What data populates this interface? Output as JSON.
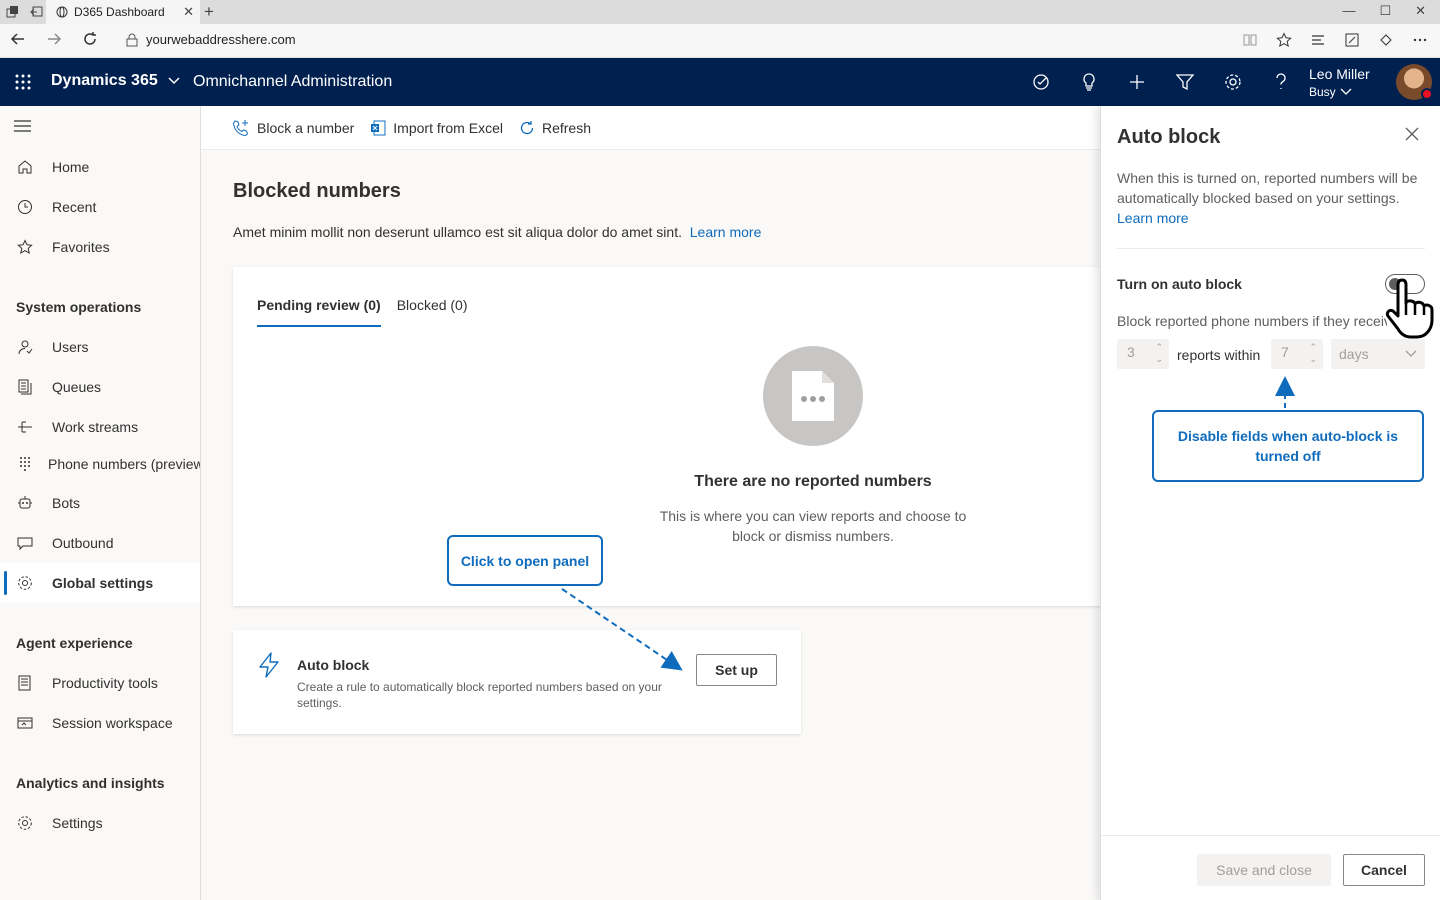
{
  "browser": {
    "tab_title": "D365 Dashboard",
    "url": "yourwebaddresshere.com"
  },
  "header": {
    "app_name": "Dynamics 365",
    "area_name": "Omnichannel Administration",
    "user_name": "Leo Miller",
    "user_status": "Busy"
  },
  "sidebar": {
    "top_items": [
      {
        "label": "Home",
        "icon": "home-icon"
      },
      {
        "label": "Recent",
        "icon": "clock-icon"
      },
      {
        "label": "Favorites",
        "icon": "star-icon"
      }
    ],
    "sections": [
      {
        "title": "System operations"
      },
      {
        "title": "Agent experience"
      },
      {
        "title": "Analytics and insights"
      }
    ],
    "items": [
      {
        "label": "Users",
        "icon": "users-icon"
      },
      {
        "label": "Queues",
        "icon": "queues-icon"
      },
      {
        "label": "Work streams",
        "icon": "workstreams-icon"
      },
      {
        "label": "Phone numbers (preview)",
        "icon": "dialpad-icon"
      },
      {
        "label": "Bots",
        "icon": "bot-icon"
      },
      {
        "label": "Outbound",
        "icon": "outbound-icon"
      },
      {
        "label": "Global settings",
        "icon": "gear-icon"
      },
      {
        "label": "Productivity tools",
        "icon": "productivity-icon"
      },
      {
        "label": "Session workspace",
        "icon": "session-icon"
      },
      {
        "label": "Settings",
        "icon": "gear-icon"
      }
    ]
  },
  "commands": {
    "block_number": "Block a number",
    "import_excel": "Import from Excel",
    "refresh": "Refresh"
  },
  "main": {
    "title": "Blocked numbers",
    "description": "Amet minim mollit non deserunt ullamco est sit aliqua dolor do amet sint.",
    "learn_more": "Learn more",
    "tabs": [
      {
        "label": "Pending review (0)"
      },
      {
        "label": "Blocked (0)"
      }
    ],
    "empty_title": "There are no reported numbers",
    "empty_desc": "This is where you can view reports and choose to block or dismiss numbers.",
    "auto_block": {
      "title": "Auto block",
      "description": "Create a rule to automatically block reported numbers based on your settings.",
      "button": "Set up"
    }
  },
  "annotations": {
    "open_panel": "Click to open panel",
    "disable_fields": "Disable fields when auto-block is turned off"
  },
  "panel": {
    "title": "Auto block",
    "description": "When this is turned on, reported numbers will be automatically blocked based on your settings.",
    "learn_more": "Learn more",
    "toggle_label": "Turn on auto block",
    "block_text": "Block reported phone numbers if they receive",
    "reports_value": "3",
    "reports_within": "reports within",
    "period_value": "7",
    "unit": "days",
    "save_button": "Save and close",
    "cancel_button": "Cancel"
  },
  "colors": {
    "header_bg": "#002050",
    "accent": "#0f6cbd",
    "presence_busy": "#e81123"
  }
}
